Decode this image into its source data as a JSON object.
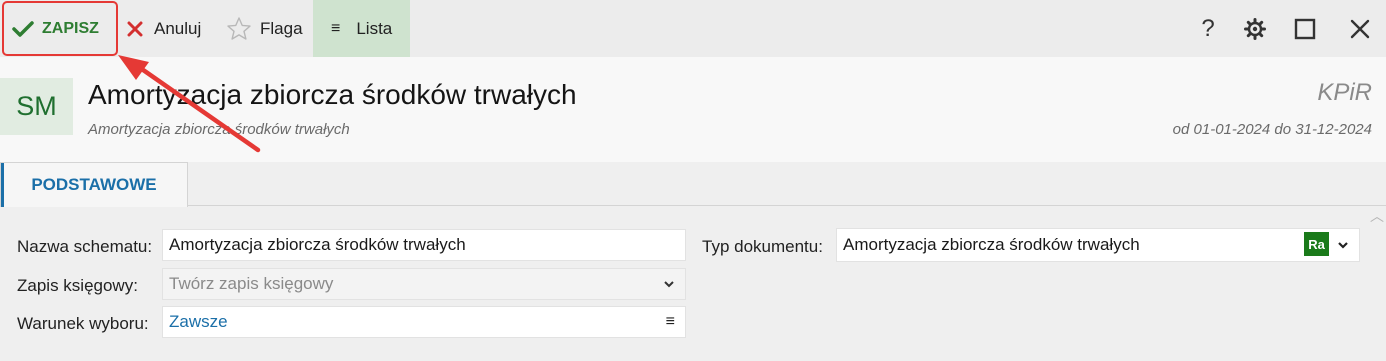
{
  "toolbar": {
    "save_label": "ZAPISZ",
    "cancel_label": "Anuluj",
    "flag_label": "Flaga",
    "list_label": "Lista",
    "list_icon": "≡",
    "help_icon": "?"
  },
  "header": {
    "badge": "SM",
    "title": "Amortyzacja zbiorcza środków trwałych",
    "subtitle": "Amortyzacja zbiorcza środków trwałych",
    "module": "KPiR",
    "period": "od 01-01-2024 do 31-12-2024"
  },
  "tabs": [
    {
      "label": "PODSTAWOWE",
      "active": true
    }
  ],
  "form": {
    "scheme_name": {
      "label": "Nazwa schematu:",
      "value": "Amortyzacja zbiorcza środków trwałych"
    },
    "accounting_entry": {
      "label": "Zapis księgowy:",
      "placeholder": "Twórz zapis księgowy"
    },
    "selection_condition": {
      "label": "Warunek wyboru:",
      "value": "Zawsze",
      "menu_icon": "≡"
    },
    "document_type": {
      "label": "Typ dokumentu:",
      "value": "Amortyzacja zbiorcza środków trwałych",
      "badge": "Ra"
    }
  },
  "colors": {
    "accent_green": "#2e7d32",
    "accent_blue": "#1b6fa8",
    "highlight_red": "#e53935",
    "list_bg": "#cfe3cf"
  },
  "icons": [
    "check-icon",
    "x-icon",
    "star-icon",
    "list-icon",
    "help-icon",
    "gear-icon",
    "maximize-icon",
    "close-icon",
    "chevron-down-icon",
    "menu-icon"
  ]
}
